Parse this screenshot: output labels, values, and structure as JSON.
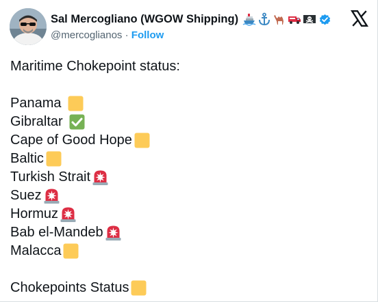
{
  "author": {
    "display_name": "Sal Mercogliano (WGOW Shipping)",
    "badges": [
      "ship-icon",
      "anchor-icon",
      "camel-icon",
      "truck-icon",
      "pirate-flag-icon"
    ],
    "handle": "@mercoglianos",
    "separator": "·",
    "follow_label": "Follow"
  },
  "tweet": {
    "heading": "Maritime Chokepoint status:",
    "items": [
      {
        "name": "Panama",
        "status": "yellow",
        "space": true
      },
      {
        "name": "Gibraltar",
        "status": "green",
        "space": true
      },
      {
        "name": "Cape of Good Hope",
        "status": "yellow",
        "space": false
      },
      {
        "name": "Baltic",
        "status": "yellow",
        "space": false
      },
      {
        "name": "Turkish Strait",
        "status": "red",
        "space": false
      },
      {
        "name": "Suez",
        "status": "red",
        "space": false
      },
      {
        "name": "Hormuz",
        "status": "red",
        "space": false
      },
      {
        "name": "Bab el-Mandeb",
        "status": "red",
        "space": false
      },
      {
        "name": "Malacca",
        "status": "yellow",
        "space": false
      }
    ],
    "footer": "Chokepoints Status",
    "footer_status": "yellow"
  },
  "colors": {
    "accent": "#1d9bf0",
    "yellow_square": "#fdcb58",
    "green_check": "#77b255",
    "red_siren": "#dd2e44"
  }
}
